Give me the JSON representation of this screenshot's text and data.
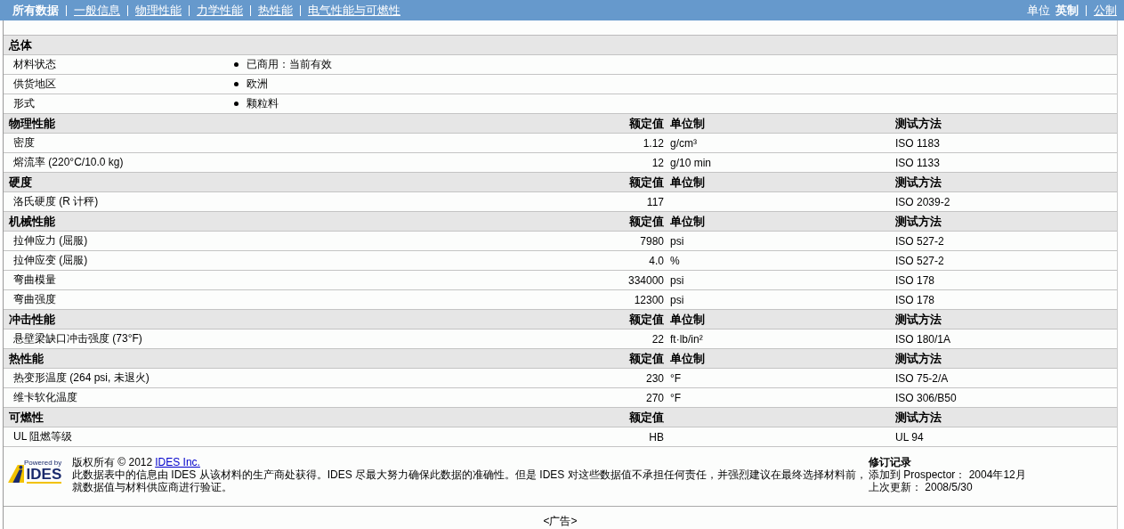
{
  "nav": {
    "tabs": [
      {
        "label": "所有数据",
        "selected": true
      },
      {
        "label": "一般信息",
        "selected": false
      },
      {
        "label": "物理性能",
        "selected": false
      },
      {
        "label": "力学性能",
        "selected": false
      },
      {
        "label": "热性能",
        "selected": false
      },
      {
        "label": "电气性能与可燃性",
        "selected": false
      }
    ],
    "units": {
      "label": "单位",
      "options": [
        {
          "label": "英制",
          "selected": true
        },
        {
          "label": "公制",
          "selected": false
        }
      ]
    }
  },
  "sections": [
    {
      "title": "总体",
      "rows": [
        {
          "kind": "bullet",
          "name": "材料状态",
          "value": "已商用：当前有效"
        },
        {
          "kind": "bullet",
          "name": "供货地区",
          "value": "欧洲"
        },
        {
          "kind": "bullet",
          "name": "形式",
          "value": "颗粒料"
        }
      ]
    },
    {
      "title": "物理性能",
      "headers": {
        "value": "额定值",
        "unit": "单位制",
        "method": "测试方法"
      },
      "rows": [
        {
          "kind": "measure",
          "name": "密度",
          "value": "1.12",
          "unit": "g/cm³",
          "method": "ISO 1183"
        },
        {
          "kind": "measure",
          "name": "熔流率 (220°C/10.0 kg)",
          "value": "12",
          "unit": "g/10 min",
          "method": "ISO 1133"
        }
      ]
    },
    {
      "title": "硬度",
      "headers": {
        "value": "额定值",
        "unit": "单位制",
        "method": "测试方法"
      },
      "rows": [
        {
          "kind": "measure",
          "name": "洛氏硬度 (R 计秤)",
          "value": "117",
          "method": "ISO 2039-2"
        }
      ]
    },
    {
      "title": "机械性能",
      "headers": {
        "value": "额定值",
        "unit": "单位制",
        "method": "测试方法"
      },
      "rows": [
        {
          "kind": "measure",
          "name": "拉伸应力 (屈服)",
          "value": "7980",
          "unit": "psi",
          "method": "ISO 527-2"
        },
        {
          "kind": "measure",
          "name": "拉伸应变 (屈服)",
          "value": "4.0",
          "unit": "%",
          "method": "ISO 527-2"
        },
        {
          "kind": "measure",
          "name": "弯曲模量",
          "value": "334000",
          "unit": "psi",
          "method": "ISO 178"
        },
        {
          "kind": "measure",
          "name": "弯曲强度",
          "value": "12300",
          "unit": "psi",
          "method": "ISO 178"
        }
      ]
    },
    {
      "title": "冲击性能",
      "headers": {
        "value": "额定值",
        "unit": "单位制",
        "method": "测试方法"
      },
      "rows": [
        {
          "kind": "measure",
          "name": "悬壁梁缺口冲击强度 (73°F)",
          "value": "22",
          "unit": "ft·lb/in²",
          "method": "ISO 180/1A"
        }
      ]
    },
    {
      "title": "热性能",
      "headers": {
        "value": "额定值",
        "unit": "单位制",
        "method": "测试方法"
      },
      "rows": [
        {
          "kind": "measure",
          "name": "热变形温度 (264 psi, 未退火)",
          "value": "230",
          "unit": "°F",
          "method": "ISO 75-2/A"
        },
        {
          "kind": "measure",
          "name": "维卡软化温度",
          "value": "270",
          "unit": "°F",
          "method": "ISO 306/B50"
        }
      ]
    },
    {
      "title": "可燃性",
      "headers": {
        "value": "额定值",
        "method": "测试方法"
      },
      "rows": [
        {
          "kind": "measure",
          "name": "UL 阻燃等级",
          "value": "HB",
          "method": "UL 94"
        }
      ]
    }
  ],
  "footer": {
    "logo": {
      "caption": "Powered by",
      "name": "IDES"
    },
    "copyright": "版权所有  © 2012",
    "copyright_link": "IDES Inc.",
    "disclaimer": [
      "此数据表中的信息由  IDES 从该材料的生产商处获得。IDES 尽最大努力确保此数据的准确性。但是  IDES 对这些数据值不承担任何责任，并强烈建议在最终选择材料前，",
      "就数据值与材料供应商进行验证。"
    ],
    "revision": {
      "title": "修订记录",
      "lines": [
        "添加到  Prospector：  2004年12月",
        "上次更新：  2008/5/30"
      ]
    }
  },
  "ad": "<广告>"
}
